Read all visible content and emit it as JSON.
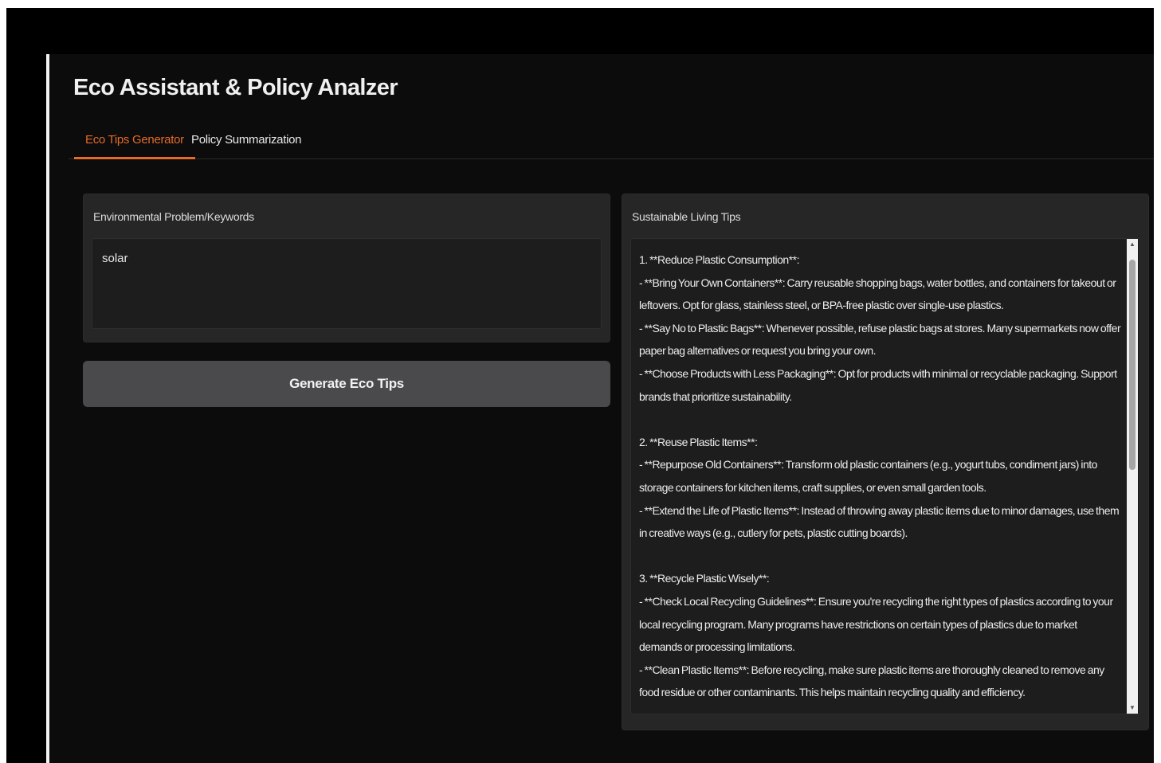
{
  "app": {
    "title": "Eco Assistant & Policy Analzer"
  },
  "tabs": [
    {
      "label": "Eco Tips Generator",
      "active": true
    },
    {
      "label": "Policy Summarization",
      "active": false
    }
  ],
  "input_panel": {
    "label": "Environmental Problem/Keywords",
    "value": "solar"
  },
  "generate_button": {
    "label": "Generate Eco Tips"
  },
  "output_panel": {
    "label": "Sustainable Living Tips",
    "lines": [
      "1. **Reduce Plastic Consumption**:",
      "   - **Bring Your Own Containers**: Carry reusable shopping bags, water bottles, and containers for takeout or leftovers. Opt for glass, stainless steel, or BPA-free plastic over single-use plastics.",
      "   - **Say No to Plastic Bags**: Whenever possible, refuse plastic bags at stores. Many supermarkets now offer paper bag alternatives or request you bring your own.",
      "   - **Choose Products with Less Packaging**: Opt for products with minimal or recyclable packaging. Support brands that prioritize sustainability.",
      "",
      "2. **Reuse Plastic Items**:",
      "   - **Repurpose Old Containers**: Transform old plastic containers (e.g., yogurt tubs, condiment jars) into storage containers for kitchen items, craft supplies, or even small garden tools.",
      "   - **Extend the Life of Plastic Items**: Instead of throwing away plastic items due to minor damages, use them in creative ways (e.g., cutlery for pets, plastic cutting boards).",
      "",
      "3. **Recycle Plastic Wisely**:",
      "   - **Check Local Recycling Guidelines**: Ensure you're recycling the right types of plastics according to your local recycling program. Many programs have restrictions on certain types of plastics due to market demands or processing limitations.",
      "   - **Clean Plastic Items**: Before recycling, make sure plastic items are thoroughly cleaned to remove any food residue or other contaminants. This helps maintain recycling quality and efficiency."
    ]
  },
  "colors": {
    "accent": "#e66a28",
    "background": "#0c0c0c",
    "panel": "#262626",
    "button": "#4a4a4d"
  }
}
